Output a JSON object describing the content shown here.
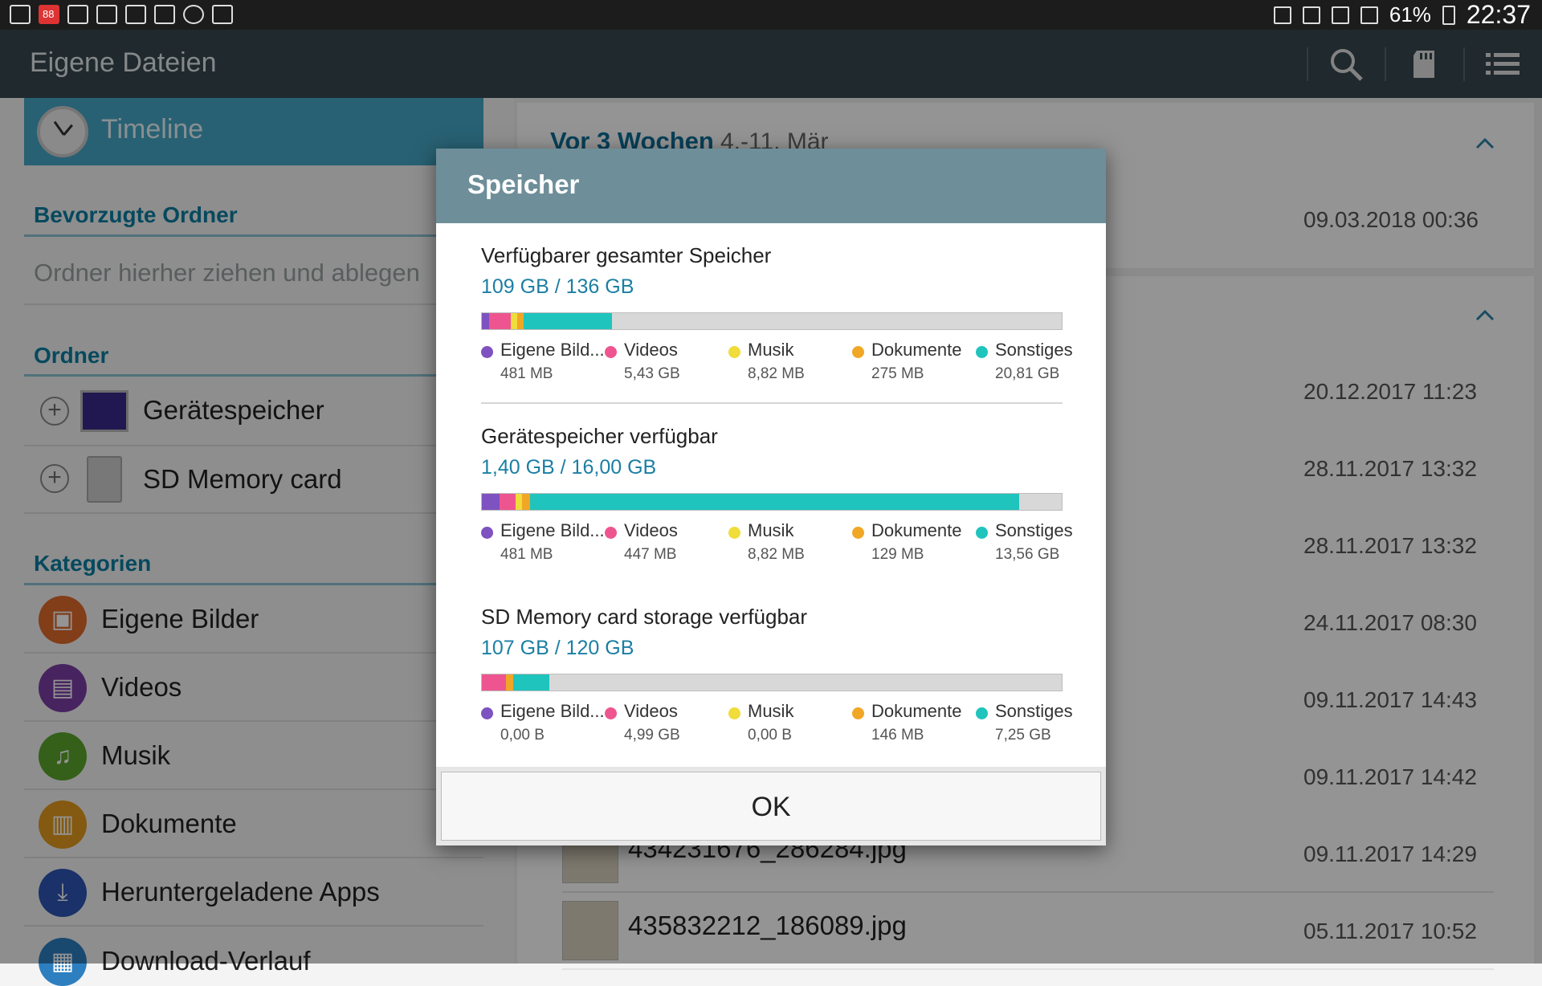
{
  "status": {
    "battery": "61%",
    "time": "22:37",
    "badge": "88"
  },
  "appbar": {
    "title": "Eigene Dateien"
  },
  "left": {
    "timeline": "Timeline",
    "favorites_heading": "Bevorzugte Ordner",
    "favorites_hint": "Ordner hierher ziehen und ablegen",
    "folders_heading": "Ordner",
    "folders": [
      "Gerätespeicher",
      "SD Memory card"
    ],
    "categories_heading": "Kategorien",
    "categories": [
      {
        "label": "Eigene Bilder",
        "color": "#e06a2b"
      },
      {
        "label": "Videos",
        "color": "#7b3fa6"
      },
      {
        "label": "Musik",
        "color": "#5ba52b"
      },
      {
        "label": "Dokumente",
        "color": "#e39a1e"
      },
      {
        "label": "Heruntergeladene Apps",
        "color": "#2d55b5"
      },
      {
        "label": "Download-Verlauf",
        "color": "#2d7fc0"
      }
    ]
  },
  "right": {
    "week_title": "Vor 3 Wochen",
    "week_range": "4.-11. Mär",
    "dates": [
      "09.03.2018 00:36",
      "20.12.2017 11:23",
      "28.11.2017 13:32",
      "28.11.2017 13:32",
      "24.11.2017 08:30",
      "09.11.2017 14:43",
      "09.11.2017 14:42",
      "09.11.2017 14:29",
      "05.11.2017 10:52"
    ],
    "files": [
      "434231676_286284.jpg",
      "435832212_186089.jpg"
    ]
  },
  "dialog": {
    "title": "Speicher",
    "ok": "OK",
    "colors": {
      "bilder": "#7e52c0",
      "videos": "#ee5590",
      "musik": "#f0dc3a",
      "dokumente": "#f0a726",
      "sonstiges": "#1fc4bd"
    },
    "sections": [
      {
        "title": "Verfügbarer gesamter Speicher",
        "value": "109 GB / 136 GB",
        "fill": [
          0.012,
          0.038,
          0.011,
          0.011,
          0.153
        ],
        "legend": [
          {
            "name": "Eigene Bild...",
            "value": "481 MB"
          },
          {
            "name": "Videos",
            "value": "5,43 GB"
          },
          {
            "name": "Musik",
            "value": "8,82 MB"
          },
          {
            "name": "Dokumente",
            "value": "275 MB"
          },
          {
            "name": "Sonstiges",
            "value": "20,81 GB"
          }
        ]
      },
      {
        "title": "Gerätespeicher verfügbar",
        "value": "1,40 GB / 16,00 GB",
        "fill": [
          0.03,
          0.028,
          0.011,
          0.014,
          0.843
        ],
        "legend": [
          {
            "name": "Eigene Bild...",
            "value": "481 MB"
          },
          {
            "name": "Videos",
            "value": "447 MB"
          },
          {
            "name": "Musik",
            "value": "8,82 MB"
          },
          {
            "name": "Dokumente",
            "value": "129 MB"
          },
          {
            "name": "Sonstiges",
            "value": "13,56 GB"
          }
        ]
      },
      {
        "title": "SD Memory card storage verfügbar",
        "value": "107 GB / 120 GB",
        "fill": [
          0.0,
          0.042,
          0.0,
          0.012,
          0.062
        ],
        "legend": [
          {
            "name": "Eigene Bild...",
            "value": "0,00 B"
          },
          {
            "name": "Videos",
            "value": "4,99 GB"
          },
          {
            "name": "Musik",
            "value": "0,00 B"
          },
          {
            "name": "Dokumente",
            "value": "146 MB"
          },
          {
            "name": "Sonstiges",
            "value": "7,25 GB"
          }
        ]
      }
    ]
  }
}
